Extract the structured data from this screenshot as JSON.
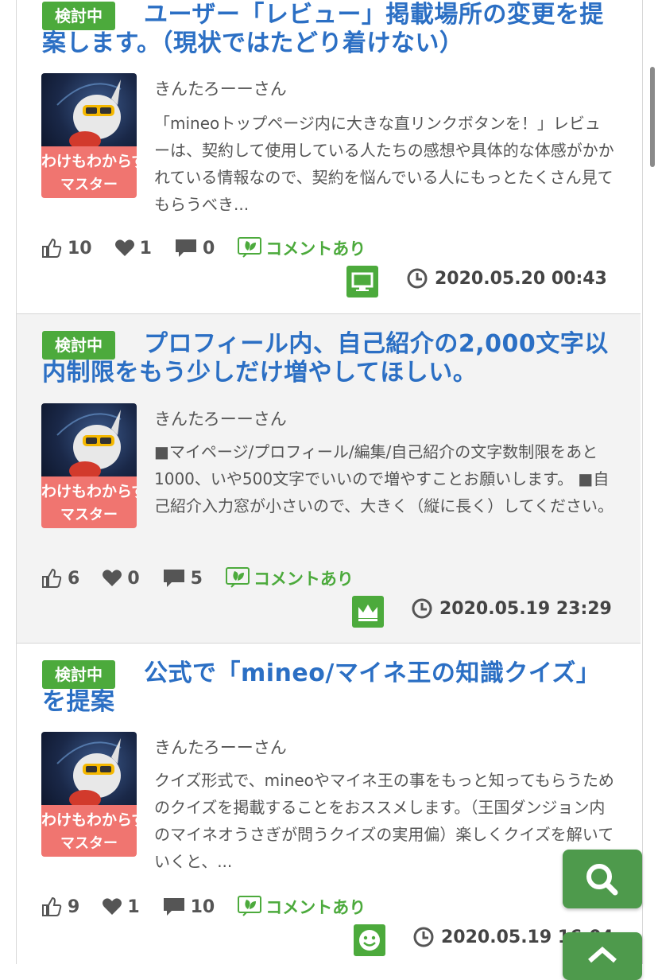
{
  "posts": [
    {
      "status": "検討中",
      "title": "ユーザー「レビュー」掲載場所の変更を提案します。（現状ではたどり着けない）",
      "author": "きんたろーーさん",
      "avatar_text1": "わけもわからず",
      "avatar_text2": "マスター",
      "excerpt": "「mineoトップページ内に大きな直リンクボタンを！」レビューは、契約して使用している人たちの感想や具体的な体感がかかれている情報なので、契約を悩んでいる人にもっとたくさん見てもらうべき...",
      "likes": "10",
      "hearts": "1",
      "comments": "0",
      "comment_label": "コメントあり",
      "device_icon": "monitor-icon",
      "timestamp": "2020.05.20 00:43"
    },
    {
      "status": "検討中",
      "title": "プロフィール内、自己紹介の2,000文字以内制限をもう少しだけ増やしてほしい。",
      "author": "きんたろーーさん",
      "avatar_text1": "わけもわからず",
      "avatar_text2": "マスター",
      "excerpt": "■マイページ/プロフィール/編集/自己紹介の文字数制限をあと1000、いや500文字でいいので増やすことお願いします。 ■自己紹介入力窓が小さいので、大きく（縦に長く）してください。",
      "likes": "6",
      "hearts": "0",
      "comments": "5",
      "comment_label": "コメントあり",
      "device_icon": "crown-icon",
      "timestamp": "2020.05.19 23:29"
    },
    {
      "status": "検討中",
      "title": "公式で「mineo/マイネ王の知識クイズ」を提案",
      "author": "きんたろーーさん",
      "avatar_text1": "わけもわからず",
      "avatar_text2": "マスター",
      "excerpt": "クイズ形式で、mineoやマイネ王の事をもっと知ってもらうためのクイズを掲載することをおススメします。（王国ダンジョン内のマイネオうさぎが問うクイズの実用偏）楽しくクイズを解いていくと、...",
      "likes": "9",
      "hearts": "1",
      "comments": "10",
      "comment_label": "コメントあり",
      "device_icon": "smiley-icon",
      "timestamp": "2020.05.19 16:04"
    }
  ],
  "colors": {
    "accent_green": "#4caa3c",
    "title_blue": "#2b6fc4",
    "avatar_band": "#f07570"
  }
}
